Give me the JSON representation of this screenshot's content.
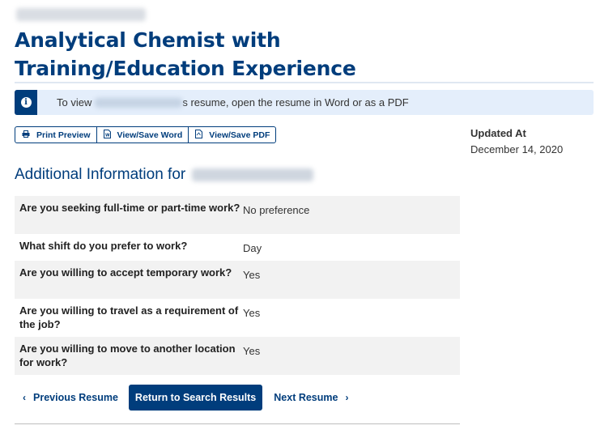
{
  "header": {
    "title_line1": "Analytical Chemist with",
    "title_line2": "Training/Education Experience"
  },
  "notice": {
    "icon": "info-icon",
    "prefix": "To view",
    "suffix": "s resume, open the resume in Word or as a PDF"
  },
  "actions": {
    "print_label": "Print Preview",
    "word_label": "View/Save Word",
    "pdf_label": "View/Save PDF"
  },
  "meta": {
    "updated_label": "Updated At",
    "updated_date": "December 14, 2020"
  },
  "section": {
    "title": "Additional Information for"
  },
  "questions": [
    {
      "q": "Are you seeking full-time or part-time work?",
      "a": "No preference"
    },
    {
      "q": "What shift do you prefer to work?",
      "a": "Day"
    },
    {
      "q": "Are you willing to accept temporary work?",
      "a": "Yes"
    },
    {
      "q": "Are you willing to travel as a requirement of the job?",
      "a": "Yes"
    },
    {
      "q": "Are you willing to move to another location for work?",
      "a": "Yes"
    }
  ],
  "pager": {
    "prev_label": "Previous Resume",
    "return_label": "Return to Search Results",
    "next_label": "Next Resume"
  },
  "colors": {
    "brand": "#003d7c",
    "notice_bg": "#e4eefb"
  }
}
